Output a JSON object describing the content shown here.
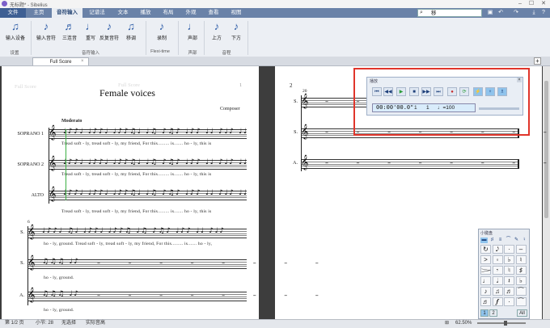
{
  "window": {
    "title": "无标题* - Sibelius",
    "controls": [
      "–",
      "☐",
      "✕"
    ]
  },
  "menu": [
    {
      "label": "文件",
      "kind": "file"
    },
    {
      "label": "主页",
      "kind": "normal"
    },
    {
      "label": "音符输入",
      "kind": "active"
    },
    {
      "label": "记谱法",
      "kind": "normal"
    },
    {
      "label": "文本",
      "kind": "normal"
    },
    {
      "label": "播放",
      "kind": "normal"
    },
    {
      "label": "布局",
      "kind": "normal"
    },
    {
      "label": "外观",
      "kind": "normal"
    },
    {
      "label": "查看",
      "kind": "normal"
    },
    {
      "label": "视图",
      "kind": "normal"
    }
  ],
  "search": {
    "value": "移"
  },
  "ribbon": {
    "buttons": [
      {
        "name": "input-device",
        "label": "输入设备",
        "icon": "♫"
      },
      {
        "name": "input-notes",
        "label": "输入音符",
        "icon": "♪"
      },
      {
        "name": "triplet",
        "label": "三连音",
        "icon": "♬"
      },
      {
        "name": "retrograde",
        "label": "重写",
        "icon": "♩"
      },
      {
        "name": "invert",
        "label": "反复音符",
        "icon": "♪"
      },
      {
        "name": "transpose",
        "label": "移调",
        "icon": "♫"
      },
      {
        "name": "record",
        "label": "录制",
        "icon": "♪"
      },
      {
        "name": "voice",
        "label": "声部",
        "icon": "♩"
      },
      {
        "name": "up",
        "label": "上方",
        "icon": "♪"
      },
      {
        "name": "down",
        "label": "下方",
        "icon": "♪"
      }
    ],
    "groups": [
      "设置",
      "音符输入",
      "Flexi-time",
      "声部",
      "音程"
    ]
  },
  "tab": {
    "label": "Full Score",
    "close": "×",
    "add": "+"
  },
  "score": {
    "ghost_header": "Full Score",
    "title": "Female voices",
    "composer": "Composer",
    "tempo": "Moderato",
    "page_num_small": "1",
    "parts": [
      "SOPRANO 1",
      "SOPRANO 2",
      "ALTO"
    ],
    "lyrics_line": "Tread    soft - ly, tread    soft - ly,  my  friend,      For    this.........    is.......     ho  -  ly, this is",
    "lyrics_alto": "Tread    soft - ly, tread    soft - ly,  my  friend,      For    this.........    is.......     ho  -  ly, this is",
    "system2_num": "6",
    "system2_parts": [
      "S.",
      "S.",
      "A."
    ],
    "lyrics_s2_1": "ho    -    ly, ground. Tread soft - ly, tread soft - ly,   my  friend,     For   this.........  is.......   ho  -  ly,",
    "lyrics_s2_2": "ho    -    ly,    ground.",
    "lyrics_s2_3": "ho    -    ly,    ground.",
    "page2_num": "2",
    "page2_bar": "20",
    "page2_parts": [
      "S.",
      "S.",
      "A."
    ]
  },
  "playback": {
    "title": "播放",
    "buttons": [
      "⏮",
      "◀◀",
      "▶",
      "■",
      "▶▶",
      "⏭",
      "●",
      "⟳",
      "⚡",
      "♆",
      "♗"
    ],
    "time": "00:00'00.0\"",
    "bar": "1",
    "beat": "1",
    "tempo": "♩=100"
  },
  "keypad": {
    "title": "小键盘",
    "tabs": [
      "▬",
      "♯",
      "≡",
      "⁀",
      "✎",
      "♮"
    ],
    "cells": [
      "↻",
      "𝅘𝅥𝅮",
      "·",
      "–",
      ">",
      "◦",
      "♭",
      "♮",
      "𝆓",
      "𝄾",
      "♮",
      "♯",
      "♩",
      "𝅗𝅥",
      "𝄽",
      "♭",
      "♪",
      "♫",
      "♬",
      "⁀",
      "♬",
      "𝆑",
      "·",
      "⁀"
    ],
    "layouts": [
      "1",
      "2",
      "All"
    ]
  },
  "status": {
    "page": "第 1/2 页",
    "bar": "小节: 28",
    "selection": "无选择",
    "pitch": "实际音高",
    "zoom": "62.50%"
  },
  "colors": {
    "accent": "#6a82a8",
    "highlight": "#e0352b"
  }
}
